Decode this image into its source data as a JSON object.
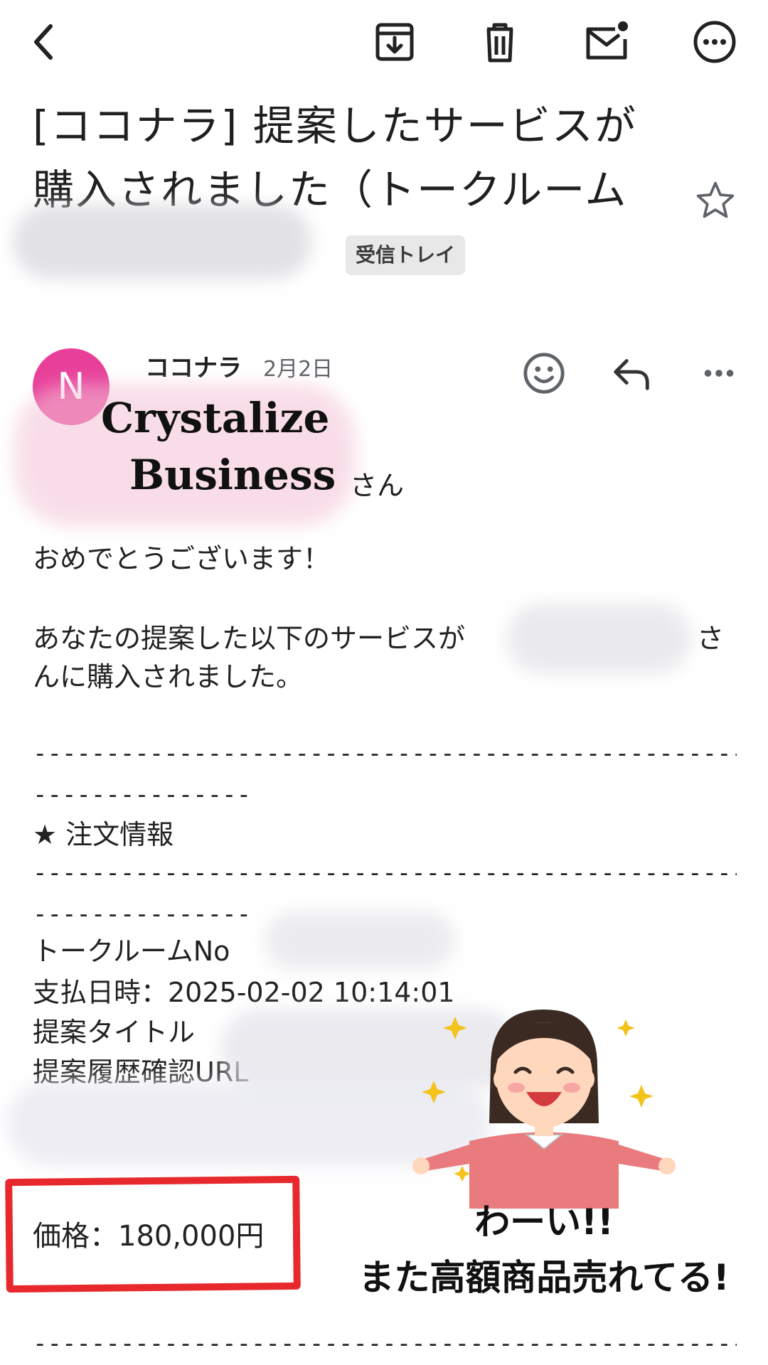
{
  "toolbar": {
    "back": "back-arrow-icon",
    "archive": "archive-icon",
    "delete": "trash-icon",
    "mark_unread": "mail-unread-icon",
    "more": "more-circle-icon"
  },
  "subject": {
    "line1": "[ココナラ] 提案したサービスが",
    "line2": "購入されました（トークルーム"
  },
  "label": "受信トレイ",
  "message": {
    "avatar_letter": "N",
    "sender": "ココナラ",
    "date": "2月2日",
    "recipient_suffix": "さん",
    "brand_line1": "Crystalize",
    "brand_line2": "Business"
  },
  "body": {
    "congrats": "おめでとうございます！",
    "intro_line1_a": "あなたの提案した以下のサービスが",
    "intro_line1_b": "さ",
    "intro_line2": "んに購入されました。",
    "dash_long": "--------------------------------------------------------",
    "dash_short": "---------------",
    "order_header": "★ 注文情報",
    "talkroom": "トークルームNo",
    "paid_at": "支払日時：2025-02-02 10:14:01",
    "proposal_title": "提案タイトル",
    "history_url": "提案履歴確認URL",
    "price": "価格：180,000円"
  },
  "overlay": {
    "caption_line1": "わーい!!",
    "caption_line2": "また高額商品売れてる!"
  },
  "colors": {
    "avatar": "#e8409a",
    "highlight": "#e7292d",
    "chip": "#e8e8e8"
  }
}
